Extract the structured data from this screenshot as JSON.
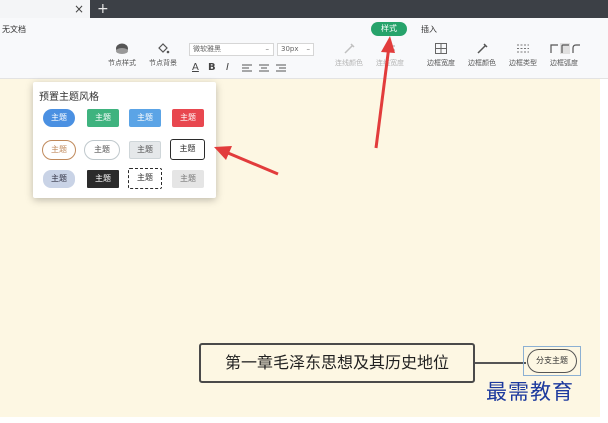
{
  "tabbar": {
    "close_glyph": "×",
    "new_glyph": "+"
  },
  "toolbar": {
    "doc_label": "无文档",
    "tabs": {
      "style": "样式",
      "insert": "插入"
    },
    "node_style": "节点样式",
    "node_bg": "节点背景",
    "font_family": "微软雅黑",
    "font_size": "30px",
    "line_color": "连线颜色",
    "line_width": "连线宽度",
    "border_width": "边框宽度",
    "border_color": "边框颜色",
    "border_type": "边框类型",
    "border_radius": "边框弧度",
    "format": {
      "underline": "A",
      "bold": "B",
      "italic": "I"
    }
  },
  "theme_panel": {
    "title": "预置主题风格",
    "item_label": "主题",
    "colors": {
      "blue": "#4a90e2",
      "green": "#3fb37f",
      "sky": "#5ba4e6",
      "red": "#e8474f",
      "brown_border": "#c08a5c",
      "gray_fill": "#e5e8ea",
      "dark": "#2b2b2b",
      "light_blue_gray": "#c9d3e6"
    }
  },
  "mindmap": {
    "central_topic": "第一章毛泽东思想及其历史地位",
    "branch_topic": "分支主题"
  },
  "watermark": "最需教育",
  "annotations": {
    "arrow_color": "#e23c3c"
  }
}
